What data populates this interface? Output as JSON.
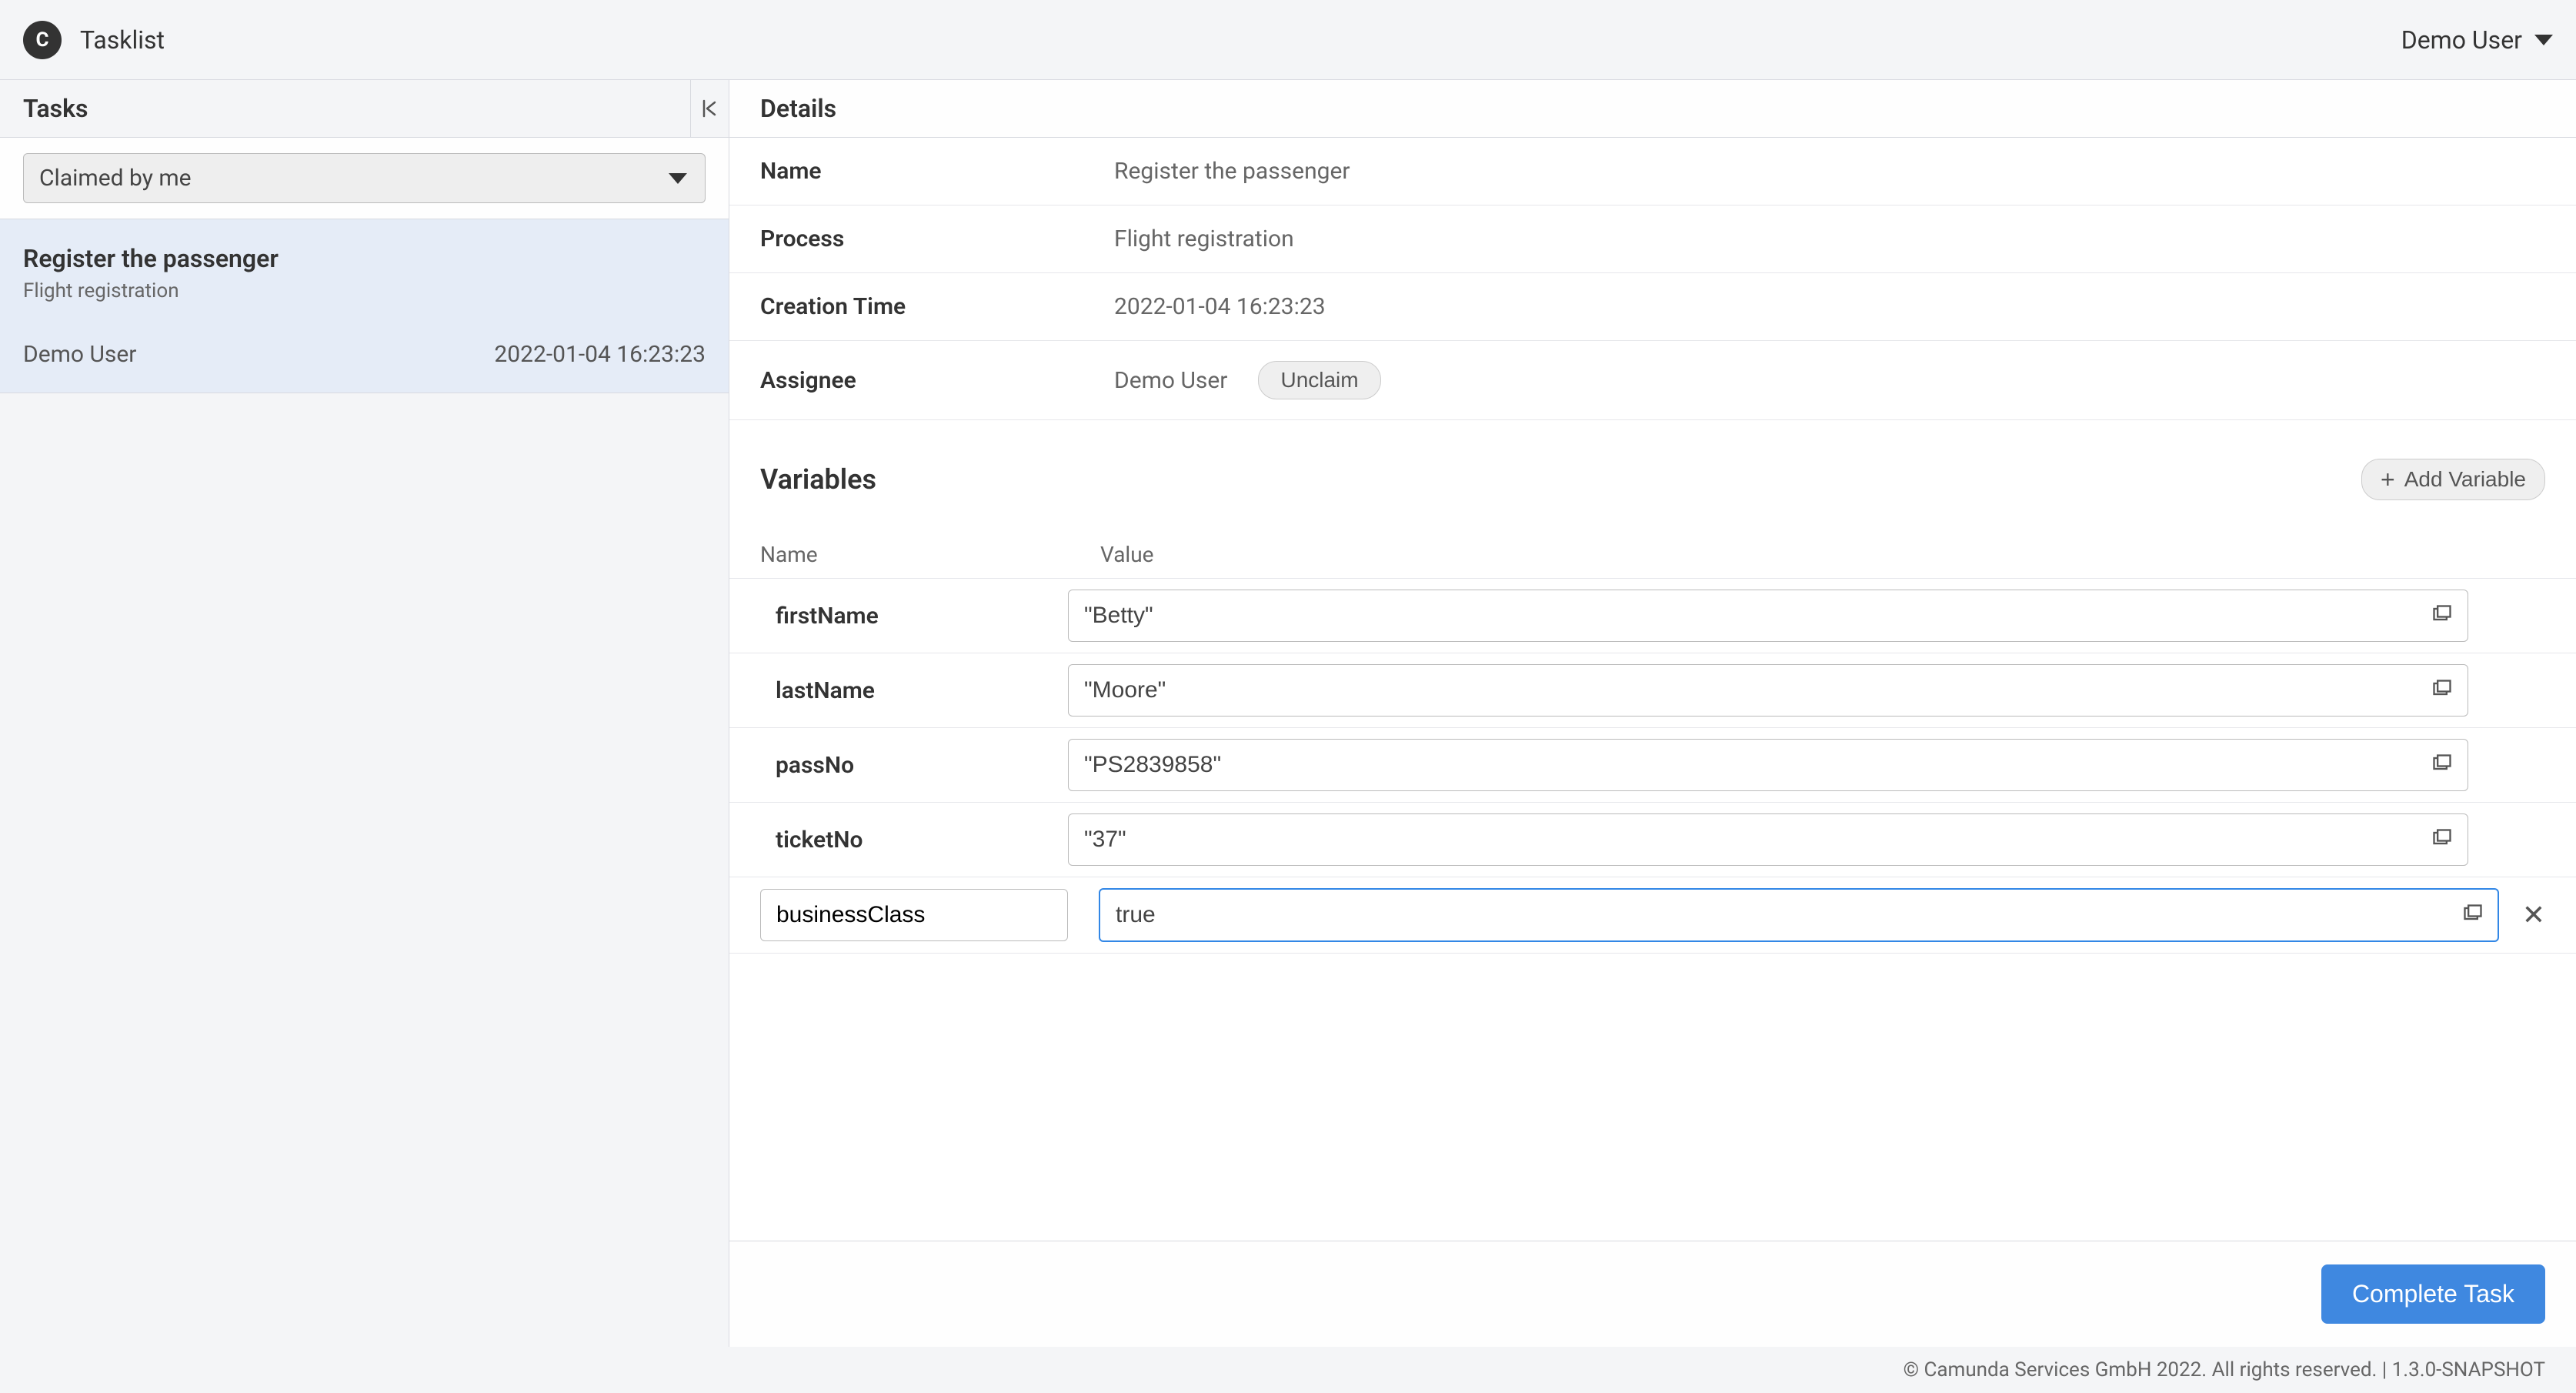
{
  "header": {
    "logo_letter": "C",
    "app_title": "Tasklist",
    "user_name": "Demo User"
  },
  "sidebar": {
    "title": "Tasks",
    "collapse_glyph": "|<",
    "filter_selected": "Claimed by me",
    "items": [
      {
        "title": "Register the passenger",
        "process": "Flight registration",
        "assignee": "Demo User",
        "date": "2022-01-04 16:23:23"
      }
    ]
  },
  "details": {
    "section_title": "Details",
    "labels": {
      "name": "Name",
      "process": "Process",
      "creation_time": "Creation Time",
      "assignee": "Assignee"
    },
    "values": {
      "name": "Register the passenger",
      "process": "Flight registration",
      "creation_time": "2022-01-04 16:23:23",
      "assignee": "Demo User"
    },
    "unclaim_label": "Unclaim"
  },
  "variables": {
    "section_title": "Variables",
    "add_button_label": "Add Variable",
    "col_name": "Name",
    "col_value": "Value",
    "rows": [
      {
        "name": "firstName",
        "value": "\"Betty\""
      },
      {
        "name": "lastName",
        "value": "\"Moore\""
      },
      {
        "name": "passNo",
        "value": "\"PS2839858\""
      },
      {
        "name": "ticketNo",
        "value": "\"37\""
      }
    ],
    "new_row": {
      "name": "businessClass",
      "value": "true"
    }
  },
  "actions": {
    "complete_label": "Complete Task"
  },
  "footer": {
    "text": "© Camunda Services GmbH 2022. All rights reserved. | 1.3.0-SNAPSHOT"
  }
}
